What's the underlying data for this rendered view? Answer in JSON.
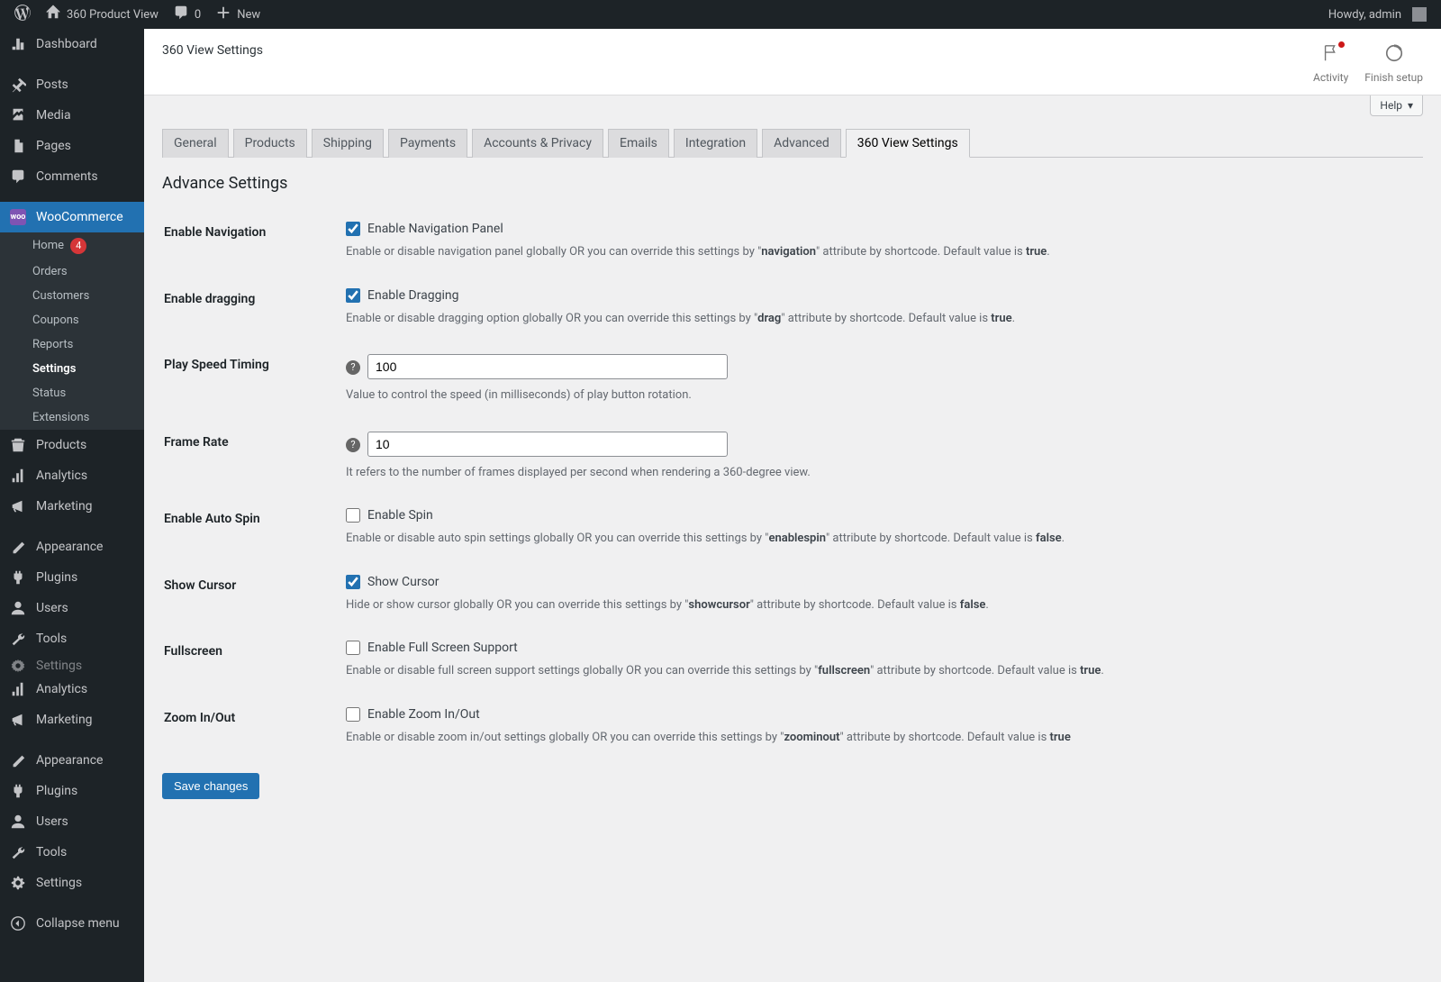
{
  "adminbar": {
    "site_name": "360 Product View",
    "comments_count": "0",
    "new_label": "New",
    "howdy": "Howdy, admin"
  },
  "adminmenu": {
    "dashboard": "Dashboard",
    "posts": "Posts",
    "media": "Media",
    "pages": "Pages",
    "comments": "Comments",
    "woocommerce": "WooCommerce",
    "woo_sub": {
      "home": "Home",
      "home_badge": "4",
      "orders": "Orders",
      "customers": "Customers",
      "coupons": "Coupons",
      "reports": "Reports",
      "settings": "Settings",
      "status": "Status",
      "extensions": "Extensions"
    },
    "products": "Products",
    "analytics": "Analytics",
    "marketing": "Marketing",
    "appearance": "Appearance",
    "plugins": "Plugins",
    "users": "Users",
    "tools": "Tools",
    "settings": "Settings",
    "analytics2": "Analytics",
    "marketing2": "Marketing",
    "appearance2": "Appearance",
    "plugins2": "Plugins",
    "users2": "Users",
    "tools2": "Tools",
    "settings2": "Settings",
    "collapse": "Collapse menu"
  },
  "header": {
    "title": "360 View Settings",
    "activity": "Activity",
    "finish_setup": "Finish setup"
  },
  "help_label": "Help",
  "tabs": [
    "General",
    "Products",
    "Shipping",
    "Payments",
    "Accounts & Privacy",
    "Emails",
    "Integration",
    "Advanced",
    "360 View Settings"
  ],
  "active_tab": "360 View Settings",
  "section_title": "Advance Settings",
  "fields": {
    "enable_navigation": {
      "label": "Enable Navigation",
      "cb_label": "Enable Navigation Panel",
      "checked": true,
      "desc_pre": "Enable or disable navigation panel globally OR you can override this settings by \"",
      "desc_attr": "navigation",
      "desc_mid": "\" attribute by shortcode. Default value is ",
      "desc_val": "true",
      "desc_post": "."
    },
    "enable_dragging": {
      "label": "Enable dragging",
      "cb_label": "Enable Dragging",
      "checked": true,
      "desc_pre": "Enable or disable dragging option globally OR you can override this settings by \"",
      "desc_attr": "drag",
      "desc_mid": "\" attribute by shortcode. Default value is ",
      "desc_val": "true",
      "desc_post": "."
    },
    "play_speed": {
      "label": "Play Speed Timing",
      "value": "100",
      "desc": "Value to control the speed (in milliseconds) of play button rotation."
    },
    "frame_rate": {
      "label": "Frame Rate",
      "value": "10",
      "desc": "It refers to the number of frames displayed per second when rendering a 360-degree view."
    },
    "enable_auto_spin": {
      "label": "Enable Auto Spin",
      "cb_label": "Enable Spin",
      "checked": false,
      "desc_pre": "Enable or disable auto spin settings globally OR you can override this settings by \"",
      "desc_attr": "enablespin",
      "desc_mid": "\" attribute by shortcode. Default value is ",
      "desc_val": "false",
      "desc_post": "."
    },
    "show_cursor": {
      "label": "Show Cursor",
      "cb_label": "Show Cursor",
      "checked": true,
      "desc_pre": "Hide or show cursor globally OR you can override this settings by \"",
      "desc_attr": "showcursor",
      "desc_mid": "\" attribute by shortcode. Default value is ",
      "desc_val": "false",
      "desc_post": "."
    },
    "fullscreen": {
      "label": "Fullscreen",
      "cb_label": "Enable Full Screen Support",
      "checked": false,
      "desc_pre": "Enable or disable full screen support settings globally OR you can override this settings by \"",
      "desc_attr": "fullscreen",
      "desc_mid": "\" attribute by shortcode. Default value is ",
      "desc_val": "true",
      "desc_post": "."
    },
    "zoom": {
      "label": "Zoom In/Out",
      "cb_label": "Enable Zoom In/Out",
      "checked": false,
      "desc_pre": "Enable or disable zoom in/out settings globally OR you can override this settings by \"",
      "desc_attr": "zoominout",
      "desc_mid": "\" attribute by shortcode. Default value is ",
      "desc_val": "true",
      "desc_post": ""
    }
  },
  "save_button": "Save changes"
}
